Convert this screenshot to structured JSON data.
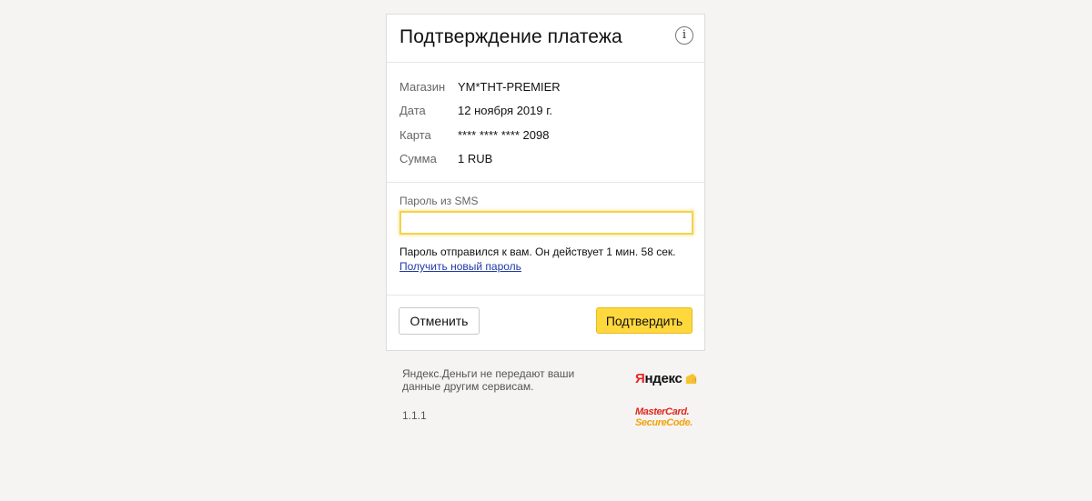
{
  "header": {
    "title": "Подтверждение платежа",
    "info_icon": "i"
  },
  "details": [
    {
      "label": "Магазин",
      "value": "YM*THT-PREMIER"
    },
    {
      "label": "Дата",
      "value": "12 ноября 2019 г."
    },
    {
      "label": "Карта",
      "value": "**** **** **** 2098"
    },
    {
      "label": "Сумма",
      "value": "1 RUB"
    }
  ],
  "sms": {
    "label": "Пароль из SMS",
    "value": "",
    "note": "Пароль отправился к вам. Он действует 1 мин. 58 сек.",
    "resend_link": "Получить новый пароль"
  },
  "actions": {
    "cancel_label": "Отменить",
    "confirm_label": "Подтвердить"
  },
  "footer": {
    "note": "Яндекс.Деньги не передают ваши данные другим сервисам.",
    "version": "1.1.1",
    "yandex_logo_first": "Я",
    "yandex_logo_rest": "ндекс",
    "mastercard_line1": "MasterCard.",
    "mastercard_line2": "SecureCode."
  },
  "colors": {
    "accent_button": "#ffd83d",
    "input_focus": "#f3d34c",
    "link": "#1f3aa6",
    "background": "#f5f4f2"
  },
  "icons": {
    "info": "info-icon",
    "wallet": "wallet-icon"
  }
}
